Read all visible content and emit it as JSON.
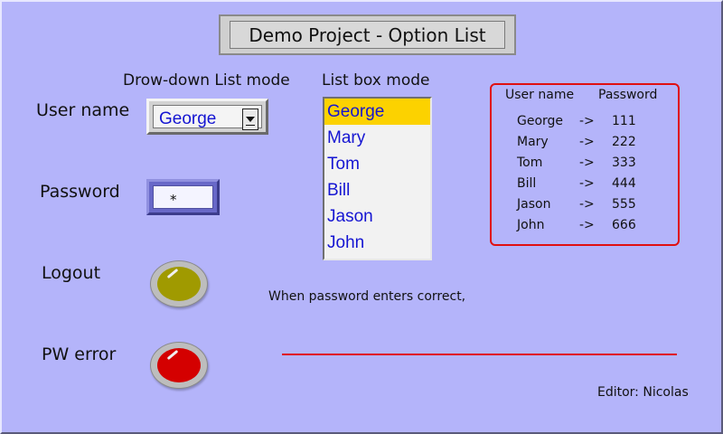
{
  "title": "Demo Project - Option List",
  "labels": {
    "dropdown_mode": "Drow-down List mode",
    "listbox_mode": "List box mode",
    "user_name": "User name",
    "password": "Password",
    "logout": "Logout",
    "pw_error": "PW error"
  },
  "dropdown": {
    "value": "George"
  },
  "password_field": {
    "value": "*"
  },
  "listbox": {
    "items": [
      "George",
      "Mary",
      "Tom",
      "Bill",
      "Jason",
      "John"
    ],
    "selected_index": 0
  },
  "pw_table": {
    "headers": [
      "User name",
      "Password"
    ],
    "arrow": "->",
    "rows": [
      {
        "user": "George",
        "password": "111"
      },
      {
        "user": "Mary",
        "password": "222"
      },
      {
        "user": "Tom",
        "password": "333"
      },
      {
        "user": "Bill",
        "password": "444"
      },
      {
        "user": "Jason",
        "password": "555"
      },
      {
        "user": "John",
        "password": "666"
      }
    ]
  },
  "message": "When password enters correct,",
  "editor": "Editor: Nicolas",
  "lamps": {
    "logout": {
      "color": "#a09a00",
      "state": "off"
    },
    "pw_error": {
      "color": "#d40000",
      "state": "on"
    }
  },
  "colors": {
    "background": "#b4b4fa",
    "selection": "#fcd200",
    "list_text": "#1515d2",
    "accent_red": "#e01010"
  }
}
